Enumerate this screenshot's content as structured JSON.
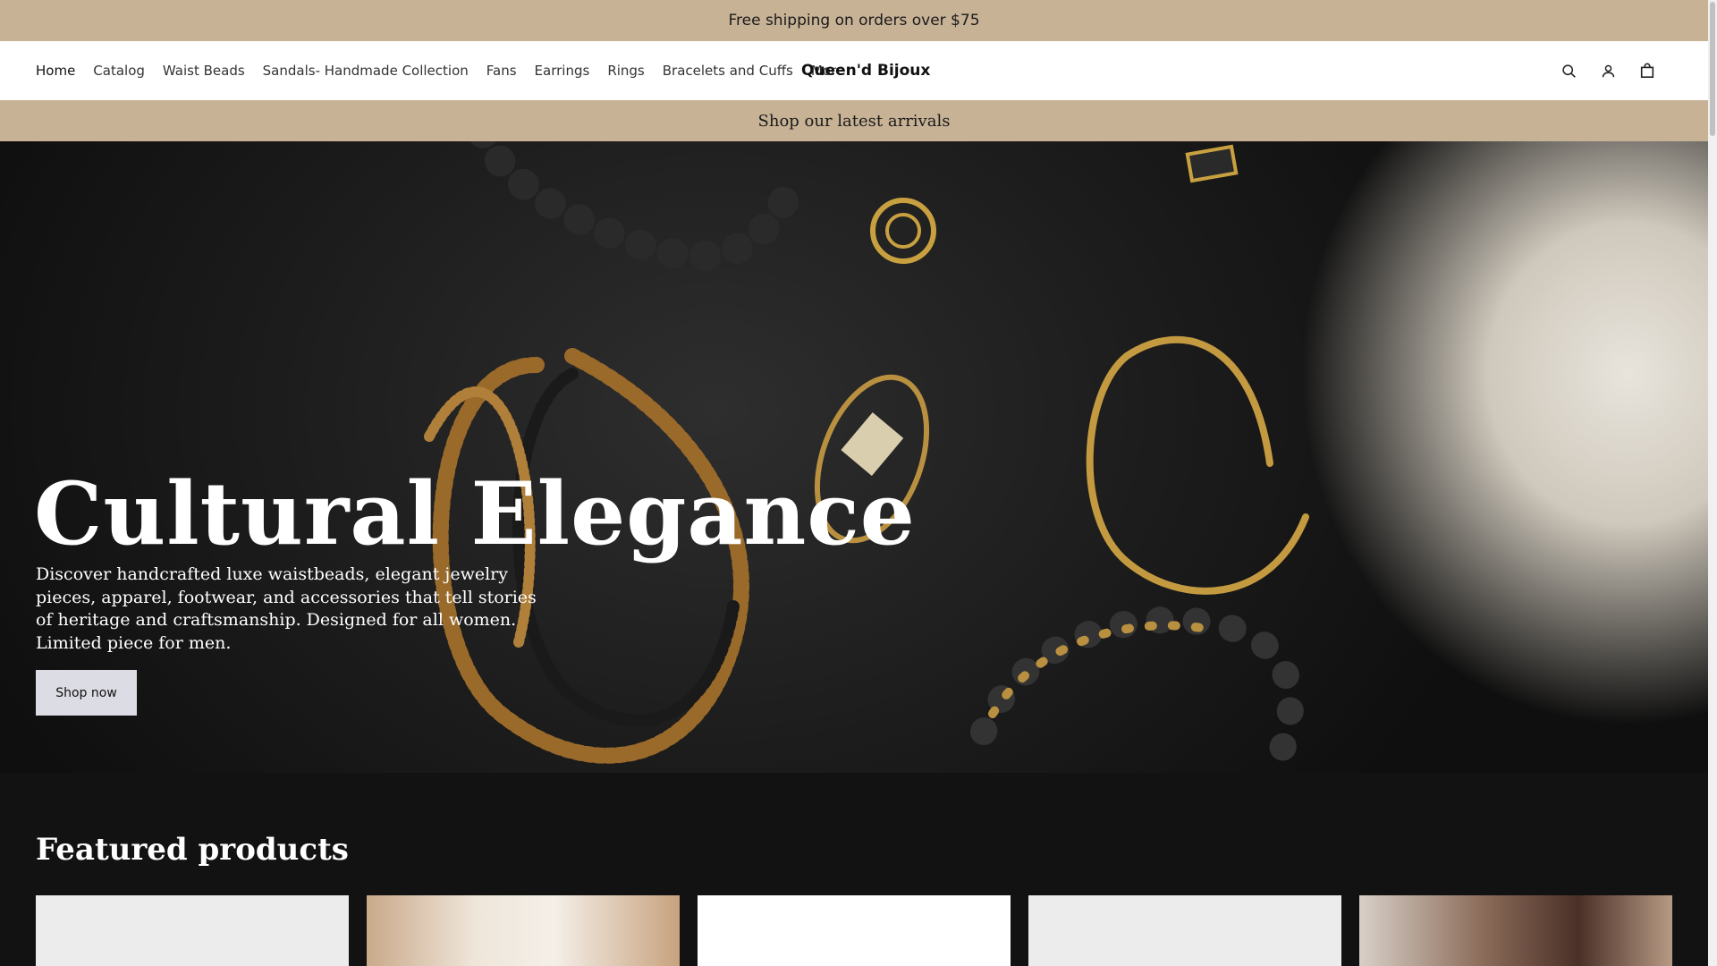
{
  "announcement": "Free shipping on orders over $75",
  "nav": {
    "items": [
      "Home",
      "Catalog",
      "Waist Beads",
      "Sandals- Handmade Collection",
      "Fans",
      "Earrings",
      "Rings",
      "Bracelets and Cuffs",
      "More"
    ]
  },
  "brand": "Queen'd Bijoux",
  "header_icons": [
    "search-icon",
    "account-icon",
    "cart-icon"
  ],
  "promo_bar": "Shop our latest arrivals",
  "hero": {
    "title": "Cultural Elegance",
    "description": "Discover handcrafted luxe waistbeads, elegant jewelry pieces, apparel, footwear, and accessories that tell stories of heritage and craftsmanship. Designed for all women. Limited piece for men.",
    "button": "Shop now"
  },
  "featured": {
    "title": "Featured products"
  },
  "colors": {
    "accent_bar": "#c8b296",
    "page_dark": "#121212",
    "button": "#dcdce4"
  }
}
